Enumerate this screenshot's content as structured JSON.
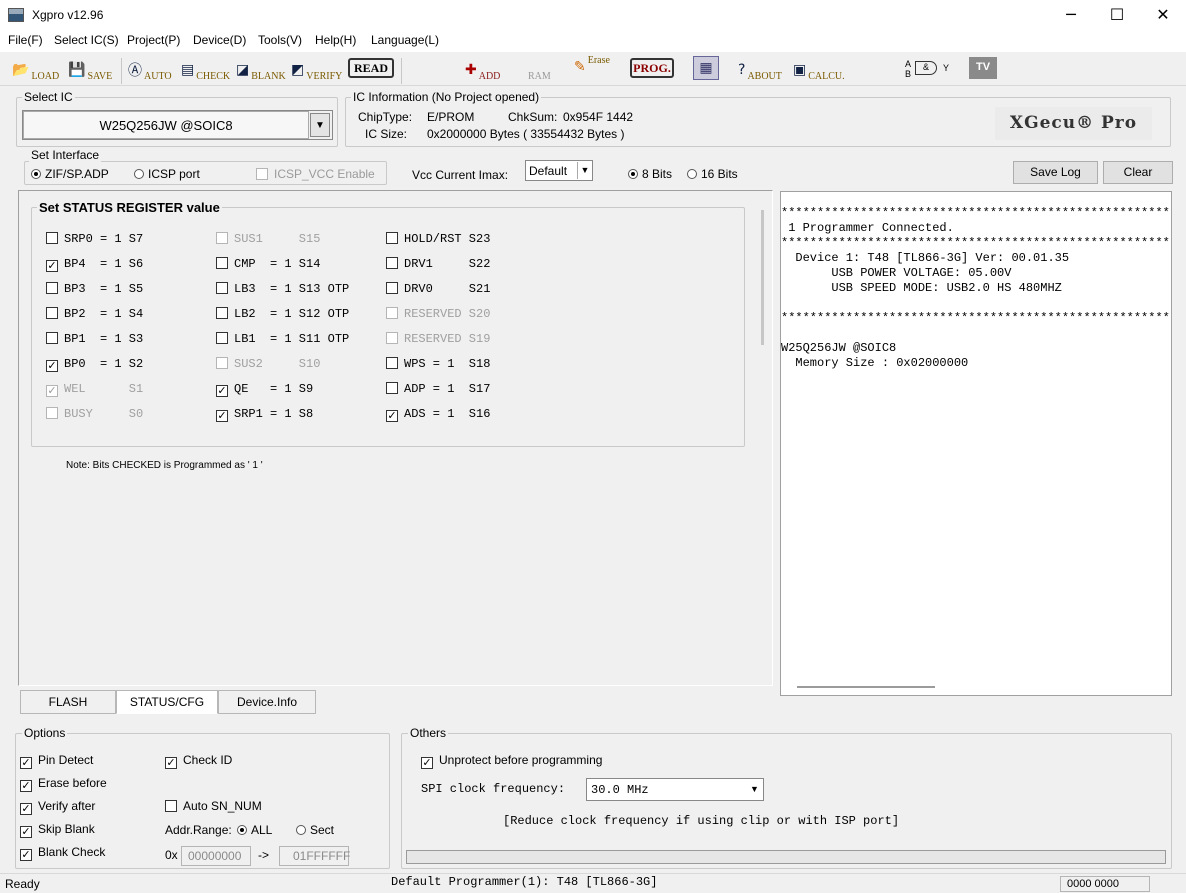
{
  "window": {
    "title": "Xgpro v12.96",
    "minimize_glyph": "─",
    "maximize_glyph": "☐",
    "close_glyph": "✕"
  },
  "menu": [
    "File(F)",
    "Select IC(S)",
    "Project(P)",
    "Device(D)",
    "Tools(V)",
    "Help(H)",
    "Language(L)"
  ],
  "toolbar": {
    "load": "LOAD",
    "save": "SAVE",
    "auto": "AUTO",
    "check": "CHECK",
    "blank": "BLANK",
    "verify": "VERIFY",
    "read": "READ",
    "add": "ADD",
    "ram": "RAM",
    "erase": "Erase",
    "prog": "PROG.",
    "about": "ABOUT",
    "calcu": "CALCU.",
    "tv": "TV",
    "logic_a": "A",
    "logic_b": "B",
    "logic_y": "Y"
  },
  "select_ic": {
    "title": "Select IC",
    "value": "W25Q256JW @SOIC8",
    "arrow": "▼"
  },
  "ic_info": {
    "title": "IC Information (No Project opened)",
    "chiptype_label": "ChipType:",
    "chiptype": "E/PROM",
    "chksum_label": "ChkSum:",
    "chksum": "0x954F 1442",
    "icsize_label": "IC Size:",
    "icsize": "0x2000000 Bytes ( 33554432 Bytes )",
    "logo": "XGecu® Pro"
  },
  "interface": {
    "title": "Set Interface",
    "zif": "ZIF/SP.ADP",
    "icsp": "ICSP port",
    "icsp_vcc": "ICSP_VCC Enable",
    "vcc_label": "Vcc Current Imax:",
    "vcc_value": "Default",
    "bits8": "8 Bits",
    "bits16": "16 Bits",
    "save_log": "Save Log",
    "clear": "Clear"
  },
  "status_register": {
    "title": "Set STATUS REGISTER value",
    "note": "Note: Bits CHECKED is Programmed as ' 1 '",
    "col1": [
      {
        "text": "SRP0 = 1 S7",
        "checked": false,
        "disabled": false
      },
      {
        "text": "BP4  = 1 S6",
        "checked": true,
        "disabled": false
      },
      {
        "text": "BP3  = 1 S5",
        "checked": false,
        "disabled": false
      },
      {
        "text": "BP2  = 1 S4",
        "checked": false,
        "disabled": false
      },
      {
        "text": "BP1  = 1 S3",
        "checked": false,
        "disabled": false
      },
      {
        "text": "BP0  = 1 S2",
        "checked": true,
        "disabled": false
      },
      {
        "text": "WEL      S1",
        "checked": true,
        "disabled": true
      },
      {
        "text": "BUSY     S0",
        "checked": false,
        "disabled": true
      }
    ],
    "col2": [
      {
        "text": "SUS1     S15",
        "checked": false,
        "disabled": true
      },
      {
        "text": "CMP  = 1 S14",
        "checked": false,
        "disabled": false
      },
      {
        "text": "LB3  = 1 S13 OTP",
        "checked": false,
        "disabled": false
      },
      {
        "text": "LB2  = 1 S12 OTP",
        "checked": false,
        "disabled": false
      },
      {
        "text": "LB1  = 1 S11 OTP",
        "checked": false,
        "disabled": false
      },
      {
        "text": "SUS2     S10",
        "checked": false,
        "disabled": true
      },
      {
        "text": "QE   = 1 S9",
        "checked": true,
        "disabled": false
      },
      {
        "text": "SRP1 = 1 S8",
        "checked": true,
        "disabled": false
      }
    ],
    "col3": [
      {
        "text": "HOLD/RST S23",
        "checked": false,
        "disabled": false
      },
      {
        "text": "DRV1     S22",
        "checked": false,
        "disabled": false
      },
      {
        "text": "DRV0     S21",
        "checked": false,
        "disabled": false
      },
      {
        "text": "RESERVED S20",
        "checked": false,
        "disabled": true
      },
      {
        "text": "RESERVED S19",
        "checked": false,
        "disabled": true
      },
      {
        "text": "WPS = 1  S18",
        "checked": false,
        "disabled": false
      },
      {
        "text": "ADP = 1  S17",
        "checked": false,
        "disabled": false
      },
      {
        "text": "ADS = 1  S16",
        "checked": true,
        "disabled": false
      }
    ]
  },
  "log": {
    "lines": [
      "**********************************************************",
      " 1 Programmer Connected.",
      "**********************************************************",
      "  Device 1: T48 [TL866-3G] Ver: 00.01.35",
      "       USB POWER VOLTAGE: 05.00V",
      "       USB SPEED MODE: USB2.0 HS 480MHZ",
      "",
      "**********************************************************",
      "",
      "W25Q256JW @SOIC8",
      "  Memory Size : 0x02000000"
    ]
  },
  "tabs": [
    "FLASH",
    "STATUS/CFG",
    "Device.Info"
  ],
  "options": {
    "title": "Options",
    "pin_detect": "Pin Detect",
    "erase_before": "Erase before",
    "verify_after": "Verify after",
    "skip_blank": "Skip Blank",
    "blank_check": "Blank Check",
    "check_id": "Check ID",
    "auto_sn": "Auto SN_NUM",
    "addr_range": "Addr.Range:",
    "all": "ALL",
    "sect": "Sect",
    "hex_prefix": "0x",
    "addr_from": "00000000",
    "arrow": "->",
    "addr_to": "01FFFFFF"
  },
  "others": {
    "title": "Others",
    "unprotect": "Unprotect before programming",
    "spi_label": "SPI clock frequency:",
    "spi_value": "30.0 MHz",
    "hint": "[Reduce clock frequency if using clip or with ISP port]"
  },
  "status": {
    "ready": "Ready",
    "programmer": "Default Programmer(1): T48 [TL866-3G]",
    "counter": "0000 0000"
  },
  "glyphs": {
    "check": "✓",
    "dropdown": "▼"
  }
}
